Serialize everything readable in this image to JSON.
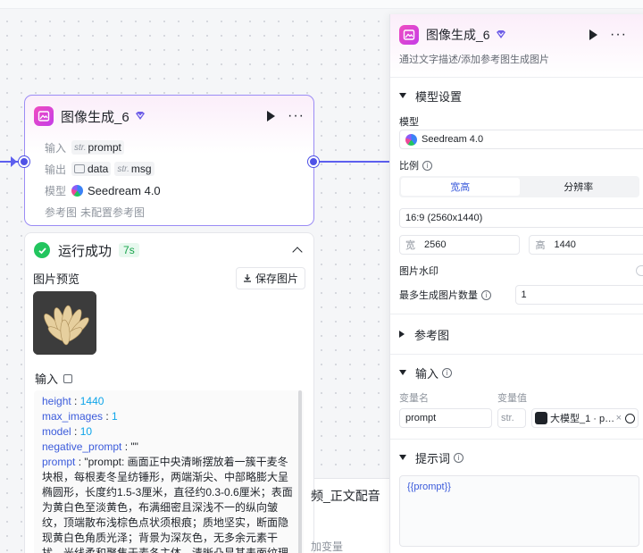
{
  "node": {
    "title": "图像生成_6",
    "input_label": "输入",
    "output_label": "输出",
    "model_label": "模型",
    "ref_label": "参考图",
    "inputs": [
      {
        "type": "str.",
        "name": "prompt"
      }
    ],
    "outputs": [
      {
        "name": "data"
      },
      {
        "type": "str.",
        "name": "msg"
      }
    ],
    "model": "Seedream 4.0",
    "ref_value": "未配置参考图"
  },
  "result": {
    "status": "运行成功",
    "time": "7s",
    "preview_label": "图片预览",
    "save_label": "保存图片",
    "input_title": "输入",
    "json_lines": [
      {
        "key": "height",
        "sep": " : ",
        "val": "1440",
        "kind": "n"
      },
      {
        "key": "max_images",
        "sep": " : ",
        "val": "1",
        "kind": "n"
      },
      {
        "key": "model",
        "sep": " : ",
        "val": "10",
        "kind": "n"
      },
      {
        "key": "negative_prompt",
        "sep": " : ",
        "val": "\"\"",
        "kind": "s"
      },
      {
        "key": "prompt",
        "sep": " : ",
        "val": "\"prompt: 画面正中央清晰摆放着一簇干麦冬块根，每根麦冬呈纺锤形，两端渐尖、中部略膨大呈椭圆形，长度约1.5-3厘米，直径约0.3-0.6厘米；表面为黄白色至淡黄色，布满细密且深浅不一的纵向皱纹，顶端散布浅棕色点状须根痕；质地坚实，断面隐现黄白色角质光泽；背景为深灰色，无多余元素干扰，光线柔和聚焦于麦冬主体，清晰凸显其表面纹理与颜色渐变特征\"",
        "kind": "s"
      }
    ]
  },
  "behind": {
    "text": "频_正文配音",
    "text2": "加变量"
  },
  "panel": {
    "title": "图像生成_6",
    "desc": "通过文字描述/添加参考图生成图片",
    "model_section": "模型设置",
    "model_label": "模型",
    "model_value": "Seedream 4.0",
    "ratio_label": "比例",
    "tab_aspect": "宽高",
    "tab_resolution": "分辨率",
    "ratio_value": "16:9 (2560x1440)",
    "width_label": "宽",
    "width_value": "2560",
    "height_label": "高",
    "height_value": "1440",
    "watermark_label": "图片水印",
    "max_label": "最多生成图片数量",
    "max_value": "1",
    "ref_section": "参考图",
    "input_section": "输入",
    "var_name_label": "变量名",
    "var_value_label": "变量值",
    "var_name": "prompt",
    "var_type": "str.",
    "var_ref": "大模型_1 · p…",
    "prompt_section": "提示词",
    "prompt_value": "{{prompt}}"
  },
  "colors": {
    "accent": "#4f52e6",
    "success": "#22c55e",
    "brand": "#d946ef"
  }
}
